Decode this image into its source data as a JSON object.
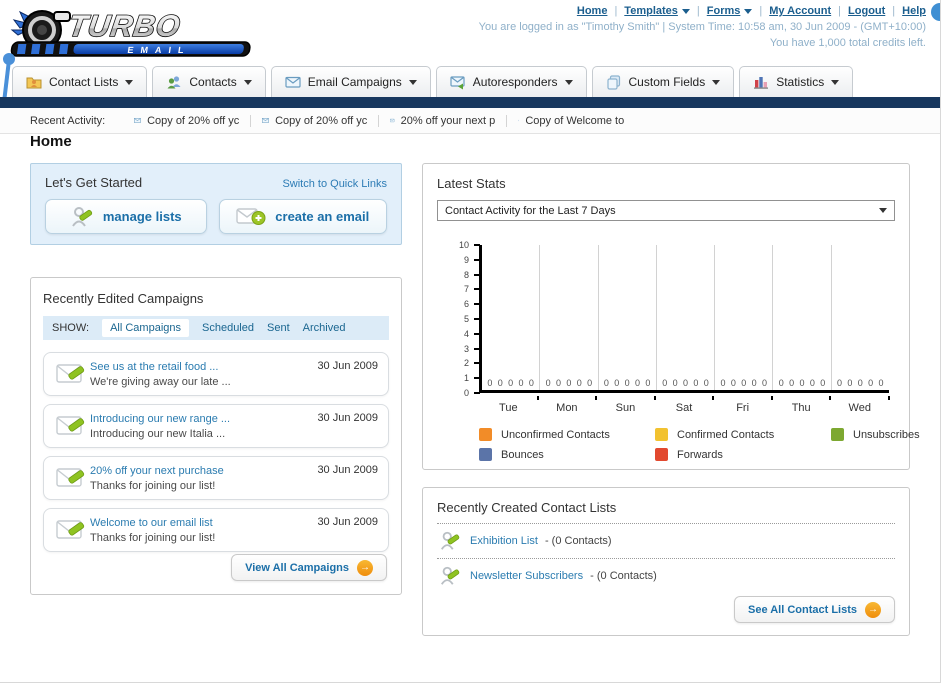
{
  "header": {
    "logo_title": "TURBO",
    "logo_subtitle": "EMAIL",
    "links": [
      {
        "label": "Home",
        "dropdown": false
      },
      {
        "label": "Templates",
        "dropdown": true
      },
      {
        "label": "Forms",
        "dropdown": true
      },
      {
        "label": "My Account",
        "dropdown": false
      },
      {
        "label": "Logout",
        "dropdown": false
      },
      {
        "label": "Help",
        "dropdown": false
      }
    ],
    "status_line1": "You are logged in as \"Timothy Smith\" | System Time: 10:58 am, 30 Jun 2009 - (GMT+10:00)",
    "status_line2": "You have 1,000 total credits left."
  },
  "main_nav": [
    {
      "label": "Contact Lists"
    },
    {
      "label": "Contacts"
    },
    {
      "label": "Email Campaigns"
    },
    {
      "label": "Autoresponders"
    },
    {
      "label": "Custom Fields"
    },
    {
      "label": "Statistics"
    }
  ],
  "recent_activity": {
    "label": "Recent Activity:",
    "items": [
      "Copy of 20% off yc",
      "Copy of 20% off yc",
      "20% off your next p",
      "Copy of Welcome to"
    ]
  },
  "page_title": "Home",
  "get_started": {
    "title": "Let's Get Started",
    "switch_link": "Switch to Quick Links",
    "manage_lists_label": "manage lists",
    "create_email_label": "create an email"
  },
  "campaigns": {
    "title": "Recently Edited Campaigns",
    "show_label": "SHOW:",
    "filters": [
      "All Campaigns",
      "Scheduled",
      "Sent",
      "Archived"
    ],
    "active_filter": "All Campaigns",
    "items": [
      {
        "title": "See us at the retail food ...",
        "subtitle": "We're giving away our late ...",
        "date": "30 Jun 2009"
      },
      {
        "title": "Introducing our new range ...",
        "subtitle": "Introducing our new Italia ...",
        "date": "30 Jun 2009"
      },
      {
        "title": "20% off your next purchase",
        "subtitle": "Thanks for joining our list!",
        "date": "30 Jun 2009"
      },
      {
        "title": "Welcome to our email list",
        "subtitle": "Thanks for joining our list!",
        "date": "30 Jun 2009"
      }
    ],
    "view_all_label": "View All Campaigns"
  },
  "stats": {
    "title": "Latest Stats",
    "selector_value": "Contact Activity for the Last 7 Days"
  },
  "chart_data": {
    "type": "bar",
    "title": "Contact Activity for the Last 7 Days",
    "categories": [
      "Tue",
      "Mon",
      "Sun",
      "Sat",
      "Fri",
      "Thu",
      "Wed"
    ],
    "series": [
      {
        "name": "Unconfirmed Contacts",
        "color": "#F28C28",
        "values": [
          0,
          0,
          0,
          0,
          0,
          0,
          0
        ]
      },
      {
        "name": "Confirmed Contacts",
        "color": "#F2C230",
        "values": [
          0,
          0,
          0,
          0,
          0,
          0,
          0
        ]
      },
      {
        "name": "Unsubscribes",
        "color": "#7DA831",
        "values": [
          0,
          0,
          0,
          0,
          0,
          0,
          0
        ]
      },
      {
        "name": "Bounces",
        "color": "#5B74A8",
        "values": [
          0,
          0,
          0,
          0,
          0,
          0,
          0
        ]
      },
      {
        "name": "Forwards",
        "color": "#E2492F",
        "values": [
          0,
          0,
          0,
          0,
          0,
          0,
          0
        ]
      }
    ],
    "xlabel": "",
    "ylabel": "",
    "ylim": [
      0,
      10
    ],
    "ytick_step": 1,
    "grid": "vertical",
    "legend_position": "bottom",
    "data_labels": true
  },
  "contact_lists": {
    "title": "Recently Created Contact Lists",
    "items": [
      {
        "name": "Exhibition List",
        "suffix": "- (0 Contacts)"
      },
      {
        "name": "Newsletter Subscribers",
        "suffix": "- (0 Contacts)"
      }
    ],
    "see_all_label": "See All Contact Lists"
  },
  "colors": {
    "navy_bar": "#17375e",
    "link_blue": "#1b5e8e",
    "panel_blue_bg": "#e2effa",
    "filter_bar_bg": "#dcebf7",
    "button_text": "#1b6fa8",
    "arrow_orange": "#ef8d0c",
    "pin_blue": "#4a90d9"
  }
}
